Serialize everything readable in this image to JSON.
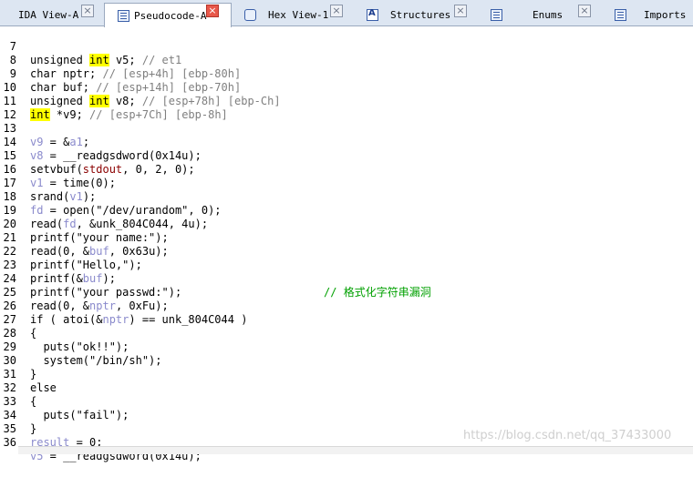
{
  "tabs": [
    {
      "label": "IDA View-A",
      "icon": "ida-view-icon"
    },
    {
      "label": "Pseudocode-A",
      "icon": "pseudocode-icon",
      "active": true
    },
    {
      "label": "Hex View-1",
      "icon": "hex-view-icon"
    },
    {
      "label": "Structures",
      "icon": "structures-icon"
    },
    {
      "label": "Enums",
      "icon": "enums-icon"
    },
    {
      "label": "Imports",
      "icon": "imports-icon"
    }
  ],
  "lines": {
    "7": {
      "n": "7",
      "a": "unsigned ",
      "kw": "int",
      "b": " v5; ",
      "c": "// et1"
    },
    "8": {
      "n": "8",
      "a": "char nptr; ",
      "c": "// [esp+4h] [ebp-80h]"
    },
    "9": {
      "n": "9",
      "a": "char buf; ",
      "c": "// [esp+14h] [ebp-70h]"
    },
    "10": {
      "n": "10",
      "a": "unsigned ",
      "kw": "int",
      "b": " v8; ",
      "c": "// [esp+78h] [ebp-Ch]"
    },
    "11": {
      "n": "11",
      "kw": "int",
      "b": " *v9; ",
      "c": "// [esp+7Ch] [ebp-8h]"
    },
    "12": {
      "n": "12"
    },
    "13": {
      "n": "13",
      "v": "v9",
      "a": " = &",
      "v2": "a1",
      "b": ";"
    },
    "14": {
      "n": "14",
      "v": "v8",
      "a": " = __readgsdword(0x14u);"
    },
    "15": {
      "n": "15",
      "a": "setvbuf(",
      "r": "stdout",
      "b": ", 0, 2, 0);"
    },
    "16": {
      "n": "16",
      "v": "v1",
      "a": " = time(0);"
    },
    "17": {
      "n": "17",
      "a": "srand(",
      "v": "v1",
      "b": ");"
    },
    "18": {
      "n": "18",
      "v": "fd",
      "a": " = open(\"/dev/urandom\", 0);"
    },
    "19": {
      "n": "19",
      "a": "read(",
      "v": "fd",
      "b": ", &unk_804C044, 4u);"
    },
    "20": {
      "n": "20",
      "a": "printf(\"your name:\");"
    },
    "21": {
      "n": "21",
      "a": "read(0, &",
      "v": "buf",
      "b": ", 0x63u);"
    },
    "22": {
      "n": "22",
      "a": "printf(\"Hello,\");"
    },
    "23": {
      "n": "23",
      "a": "printf(&",
      "v": "buf",
      "b": ");",
      "cmt": "// ",
      "cn": "格式化字符串漏洞"
    },
    "24": {
      "n": "24",
      "a": "printf(\"your passwd:\");"
    },
    "25": {
      "n": "25",
      "a": "read(0, &",
      "v": "nptr",
      "b": ", 0xFu);"
    },
    "26": {
      "n": "26",
      "a": "if ( atoi(&",
      "v": "nptr",
      "b": ") == unk_804C044 )"
    },
    "27": {
      "n": "27",
      "a": "{"
    },
    "28": {
      "n": "28",
      "a": "  puts(\"ok!!\");"
    },
    "29": {
      "n": "29",
      "a": "  system(\"/bin/sh\");"
    },
    "30": {
      "n": "30",
      "a": "}"
    },
    "31": {
      "n": "31",
      "a": "else"
    },
    "32": {
      "n": "32",
      "a": "{"
    },
    "33": {
      "n": "33",
      "a": "  puts(\"fail\");"
    },
    "34": {
      "n": "34",
      "a": "}"
    },
    "35": {
      "n": "35",
      "v": "result",
      "a": " = 0;"
    },
    "36": {
      "n": "36",
      "v": "v5",
      "a": " = __readgsdword(0x14u);"
    }
  },
  "watermark": "https://blog.csdn.net/qq_37433000"
}
